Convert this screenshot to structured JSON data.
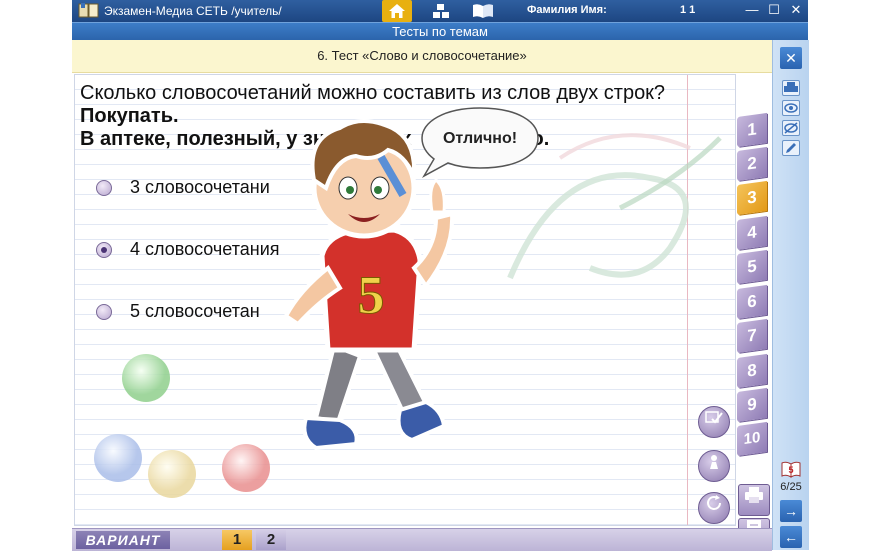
{
  "window": {
    "title": "Экзамен-Медиа СЕТЬ /учитель/",
    "user_label": "Фамилия Имя:",
    "user_name": "1 1",
    "minimize": "—",
    "maximize": "☐",
    "close": "✕"
  },
  "header": {
    "title": "Тесты по темам"
  },
  "test": {
    "title": "6. Тест «Слово и словосочетание»"
  },
  "question": {
    "line1": "Сколько словосочетаний можно составить из слов двух строк?",
    "line2": "Покупать.",
    "line3_start": "В аптеке, полезный, у зна",
    "line3_mid": "их",
    "line3_end": "о."
  },
  "options": [
    {
      "label": "3 словосочетани",
      "checked": false
    },
    {
      "label": "4 словосочетания",
      "checked": true
    },
    {
      "label": "5 словосочетан",
      "checked": false
    }
  ],
  "feedback": {
    "text": "Отлично!"
  },
  "mascot": {
    "shirt_number": "5"
  },
  "tabs": [
    "1",
    "2",
    "3",
    "4",
    "5",
    "6",
    "7",
    "8",
    "9",
    "10"
  ],
  "active_tab": "3",
  "rightbar": {
    "close": "✕",
    "counter": "6/25",
    "next": "→",
    "back": "←"
  },
  "variant": {
    "label": "ВАРИАНТ",
    "options": [
      "1",
      "2"
    ],
    "active": "1"
  },
  "icons": {
    "home": "home-icon",
    "blocks": "blocks-icon",
    "book": "book-icon",
    "print": "printer-icon",
    "eye": "eye-icon",
    "eye_off": "eye-crossed-icon",
    "pencil": "pencil-icon"
  },
  "colors": {
    "titlebar": "#1d4682",
    "header": "#3d7dc8",
    "testbar": "#fbf6cf",
    "tab": "#8f7cb5",
    "tab_active": "#e39a18"
  }
}
